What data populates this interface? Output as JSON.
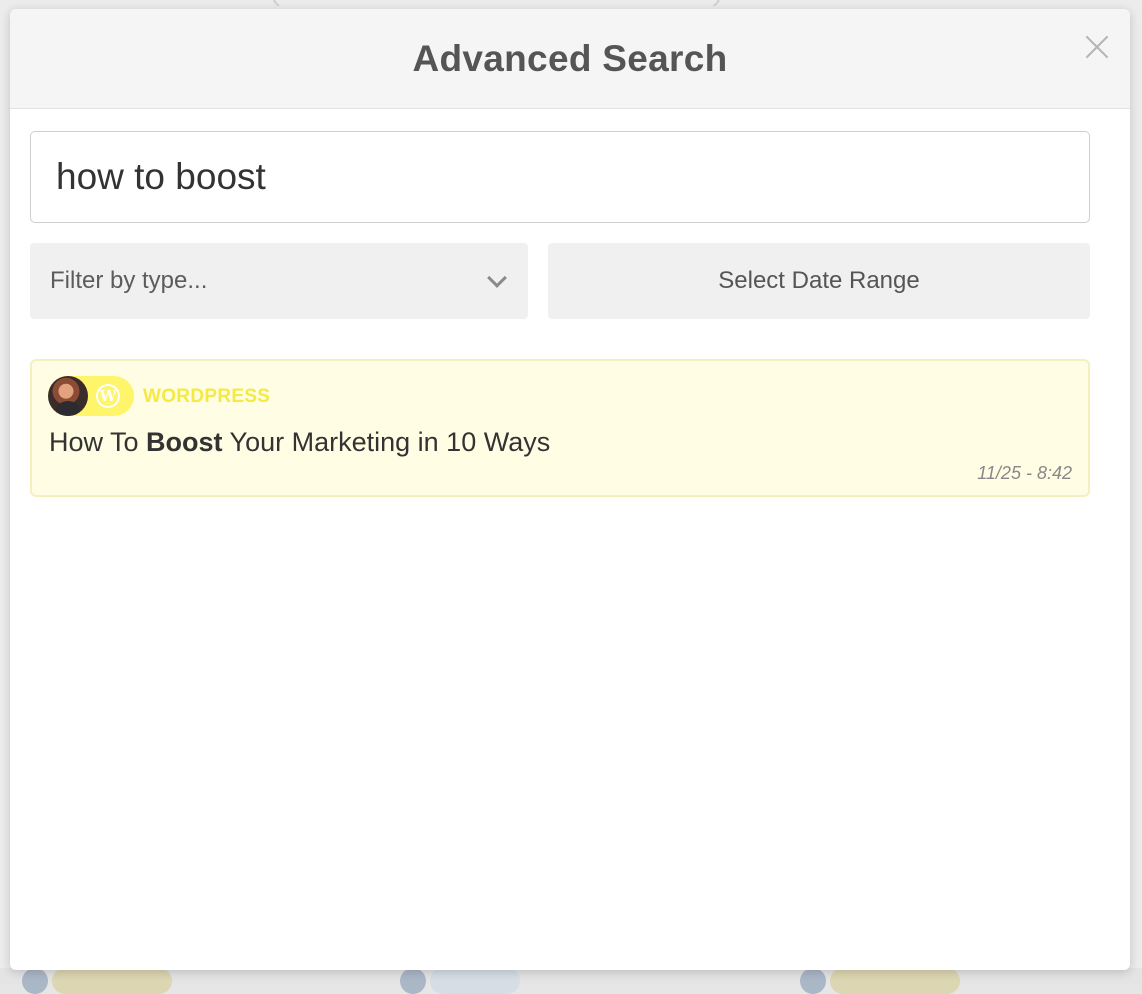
{
  "modal": {
    "title": "Advanced Search",
    "close_icon": "close-icon"
  },
  "search": {
    "value": "how to boost"
  },
  "filters": {
    "type_placeholder": "Filter by type...",
    "type_icon": "chevron-down-icon",
    "date_range_label": "Select Date Range"
  },
  "results": [
    {
      "source": "WORDPRESS",
      "source_icon": "wordpress-icon",
      "title_before": "How To ",
      "title_match": "Boost",
      "title_after": " Your Marketing in 10 Ways",
      "time": "11/25 - 8:42"
    }
  ],
  "colors": {
    "result_bg": "#fffde3",
    "badge": "#fff56b",
    "source_label": "#f4ea43"
  }
}
